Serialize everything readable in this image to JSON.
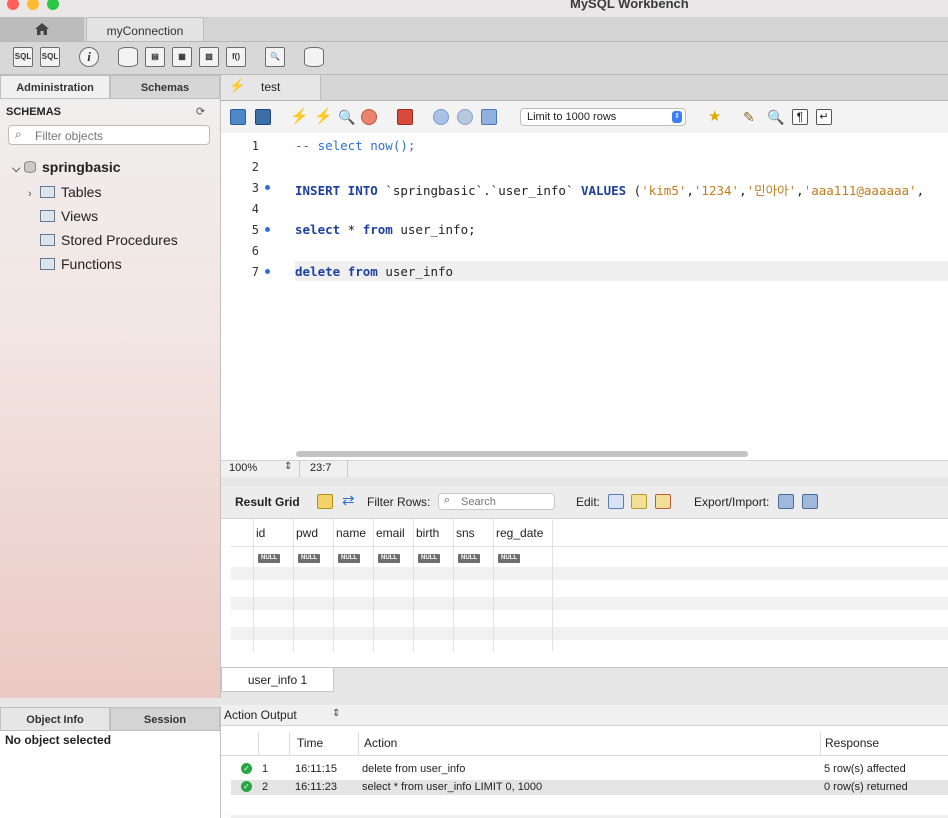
{
  "window": {
    "title": "MySQL Workbench"
  },
  "tabs": {
    "connection_label": "myConnection"
  },
  "toolbar": {
    "icons": [
      "sql-new-icon",
      "sql-open-icon",
      "info-icon",
      "db-add-icon",
      "table-add-icon",
      "view-add-icon",
      "routine-add-icon",
      "function-add-icon",
      "inspector-icon",
      "reconnect-icon"
    ]
  },
  "sidebar": {
    "tabs": {
      "administration": "Administration",
      "schemas": "Schemas"
    },
    "header": "SCHEMAS",
    "filter_placeholder": "Filter objects",
    "tree": {
      "schema": "springbasic",
      "items": [
        "Tables",
        "Views",
        "Stored Procedures",
        "Functions"
      ]
    }
  },
  "info_panel": {
    "tabs": {
      "object_info": "Object Info",
      "session": "Session"
    },
    "message": "No object selected"
  },
  "query_tab": {
    "label": "test"
  },
  "editor_toolbar": {
    "limit_label": "Limit to 1000 rows"
  },
  "editor": {
    "line_numbers": [
      "1",
      "2",
      "3",
      "4",
      "5",
      "6",
      "7"
    ],
    "lines": {
      "l1": "-- select now();",
      "l3_kw1": "INSERT INTO",
      "l3_ident": " `springbasic`.`user_info` ",
      "l3_kw2": "VALUES",
      "l3_open": " (",
      "l3_s1": "'kim5'",
      "l3_s2": "'1234'",
      "l3_s3": "'민아아'",
      "l3_s4": "'aaa111@aaaaaa'",
      "l5_kw1": "select",
      "l5_mid": " * ",
      "l5_kw2": "from",
      "l5_rest": " user_info;",
      "l7_kw1": "delete",
      "l7_kw2": "from",
      "l7_rest": " user_info"
    },
    "status": {
      "zoom": "100%",
      "cursor_pos": "23:7"
    }
  },
  "result": {
    "grid_label": "Result Grid",
    "filter_label": "Filter Rows:",
    "search_placeholder": "Search",
    "edit_label": "Edit:",
    "export_label": "Export/Import:",
    "columns": [
      "id",
      "pwd",
      "name",
      "email",
      "birth",
      "sns",
      "reg_date"
    ],
    "null_label": "NULL",
    "tab_label": "user_info 1"
  },
  "output": {
    "selector_label": "Action Output",
    "columns": {
      "time": "Time",
      "action": "Action",
      "response": "Response"
    },
    "rows": [
      {
        "num": "1",
        "time": "16:11:15",
        "action": "delete from user_info",
        "response": "5 row(s) affected"
      },
      {
        "num": "2",
        "time": "16:11:23",
        "action": "select * from user_info LIMIT 0, 1000",
        "response": "0 row(s) returned"
      }
    ]
  },
  "colors": {
    "accent": "#2f6fd8",
    "keyword": "#1d3fa0",
    "string": "#c47a18",
    "ok": "#27a744"
  }
}
